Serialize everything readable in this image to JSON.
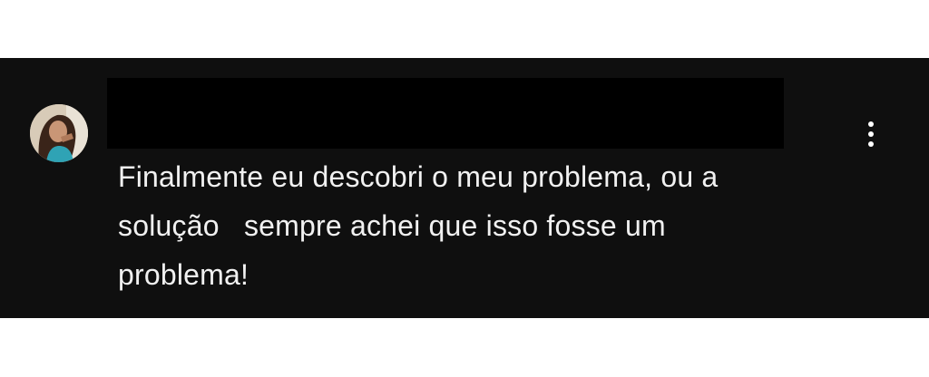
{
  "comment": {
    "author_avatar_icon": "user-avatar-photo",
    "author_name_redacted": true,
    "text": "Finalmente eu descobri o meu problema, ou a\nsolução   sempre achei que isso fosse um\nproblema!",
    "more_actions_icon": "vertical-ellipsis-icon"
  },
  "colors": {
    "card_background": "#0f0f0f",
    "text": "#f1f1f1",
    "redaction": "#000000",
    "page_background": "#ffffff"
  }
}
